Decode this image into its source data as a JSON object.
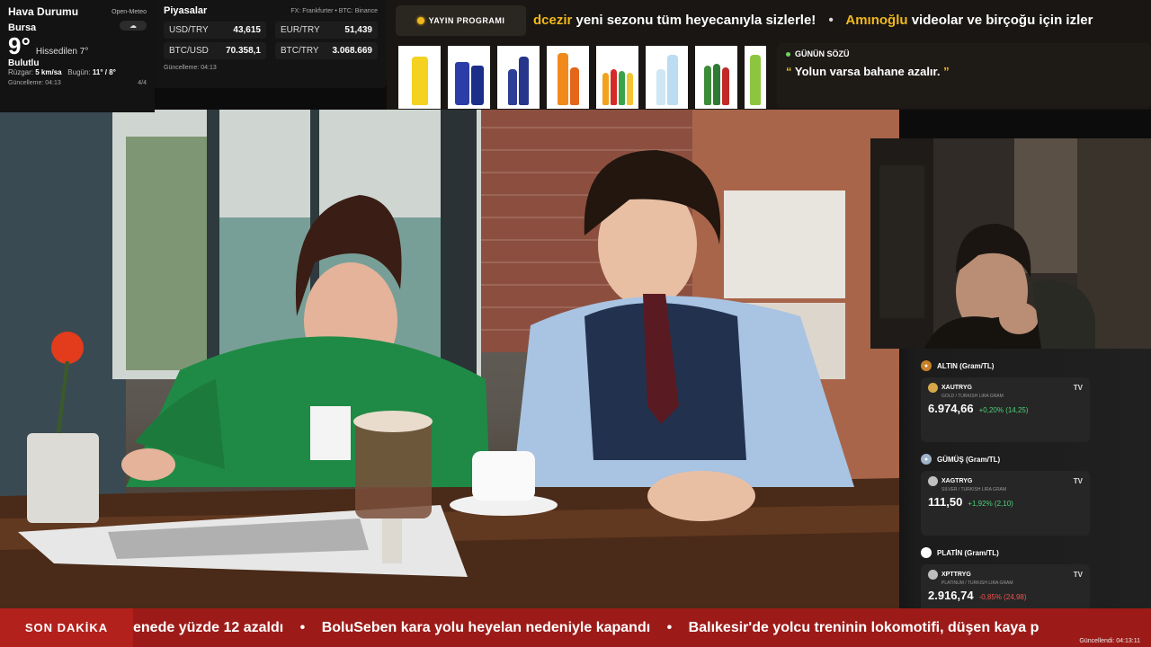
{
  "weather": {
    "title": "Hava Durumu",
    "source": "Open-Meteo",
    "city": "Bursa",
    "temp": "9°",
    "feels": "Hissedilen 7°",
    "condition": "Bulutlu",
    "wind_label": "Rüzgar:",
    "wind_value": "5 km/sa",
    "today_label": "Bugün:",
    "today_value": "11° / 8°",
    "updated": "Güncelleme: 04:13",
    "page": "4/4",
    "icon": "cloud-icon"
  },
  "markets": {
    "title": "Piyasalar",
    "source": "FX: Frankfurter • BTC: Binance",
    "items": [
      {
        "key": "USD/TRY",
        "value": "43,615"
      },
      {
        "key": "EUR/TRY",
        "value": "51,439"
      },
      {
        "key": "BTC/USD",
        "value": "70.358,1"
      },
      {
        "key": "BTC/TRY",
        "value": "3.068.669"
      }
    ],
    "updated": "Güncelleme: 04:13"
  },
  "schedule": {
    "label": "YAYIN PROGRAMI"
  },
  "ticker_top": {
    "a_name": "dcezir",
    "a_text": "yeni sezonu tüm heyecanıyla sizlerle!",
    "b_name": "Amınoğlu",
    "b_text": "videolar ve birçoğu için izler",
    "separator": "•"
  },
  "quote": {
    "heading": "GÜNÜN SÖZÜ",
    "open": "“",
    "text": "Yolun varsa bahane azalır.",
    "close": "”"
  },
  "metals": [
    {
      "title": "ALTIN (Gram/TL)",
      "symbol": "XAUTRYG",
      "sub": "GOLD / TURKISH LIRA GRAM",
      "value": "6.974,66",
      "change": "+0,20% (14,25)",
      "direction": "up",
      "medal_color": "#c8802a",
      "coin_color": "#d6a84a"
    },
    {
      "title": "GÜMÜŞ (Gram/TL)",
      "symbol": "XAGTRYG",
      "sub": "SILVER / TURKISH LIRA GRAM",
      "value": "111,50",
      "change": "+1,92% (2,10)",
      "direction": "up",
      "medal_color": "#9fb3c8",
      "coin_color": "#c0c0c0"
    },
    {
      "title": "PLATİN (Gram/TL)",
      "symbol": "XPTTRYG",
      "sub": "PLATINUM / TURKISH LIRA GRAM",
      "value": "2.916,74",
      "change": "-0,85% (24,98)",
      "direction": "down",
      "medal_color": "#ffffff",
      "coin_color": "#bdbdbd"
    }
  ],
  "tv_label": "TV",
  "breaking": {
    "label": "SON DAKİKA",
    "items": [
      "enede yüzde 12 azaldı",
      "BoluSeben kara yolu heyelan nedeniyle kapandı",
      "Balıkesir'de yolcu treninin lokomotifi, düşen kaya p"
    ],
    "separator": "•",
    "updated": "Güncellendi: 04:13:11"
  },
  "colors": {
    "accent": "#f1b81c",
    "breaking_bg": "#9c1b18",
    "up": "#4fcf78",
    "down": "#ef5350"
  }
}
